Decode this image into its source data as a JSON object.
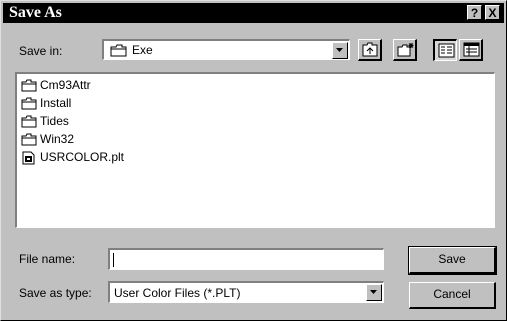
{
  "window": {
    "title": "Save As",
    "help_label": "?",
    "close_label": "X"
  },
  "save_in": {
    "label": "Save in:",
    "value": "Exe"
  },
  "files": [
    {
      "name": "Cm93Attr",
      "type": "folder"
    },
    {
      "name": "Install",
      "type": "folder"
    },
    {
      "name": "Tides",
      "type": "folder"
    },
    {
      "name": "Win32",
      "type": "folder"
    },
    {
      "name": "USRCOLOR.plt",
      "type": "file"
    }
  ],
  "file_name": {
    "label": "File name:",
    "value": ""
  },
  "save_as_type": {
    "label": "Save as type:",
    "value": "User Color Files (*.PLT)"
  },
  "buttons": {
    "save": "Save",
    "cancel": "Cancel"
  },
  "icons": {
    "folder": "folder-icon",
    "file": "file-icon",
    "up": "up-one-level-icon",
    "new_folder": "new-folder-icon",
    "list": "list-view-icon",
    "details": "details-view-icon"
  }
}
